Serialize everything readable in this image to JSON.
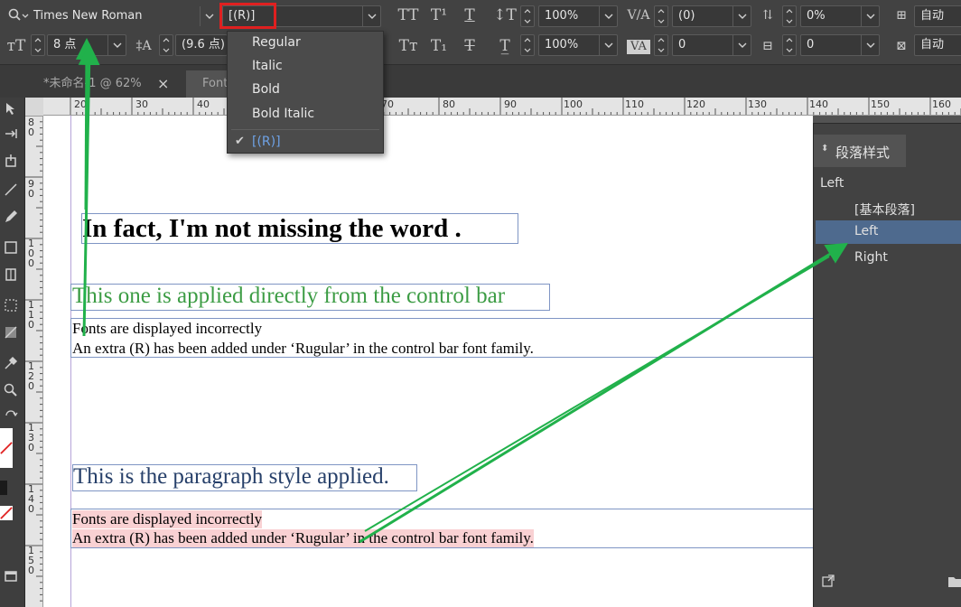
{
  "control_bar": {
    "font_family": "Times New Roman",
    "font_style": "[(R)]",
    "font_size": "8 点",
    "leading": "(9.6 点)",
    "vertical_scale": "100%",
    "horizontal_scale": "100%",
    "kerning": "(0)",
    "tracking": "0",
    "baseline_shift": "0%",
    "skew": "0",
    "auto_1": "自动",
    "auto_2": "自动"
  },
  "tabs": [
    {
      "label": "*未命名-1 @ 62%",
      "close": "×"
    },
    {
      "label": "Font"
    }
  ],
  "font_style_menu": {
    "items": [
      "Regular",
      "Italic",
      "Bold",
      "Bold Italic",
      "[(R)]"
    ],
    "selected_index": 4,
    "check": "✔"
  },
  "ruler_h": [
    "20",
    "30",
    "40",
    "70",
    "80",
    "90",
    "100",
    "110",
    "120",
    "130",
    "140",
    "150",
    "160"
  ],
  "ruler_v": [
    "8\n0",
    "9\n0",
    "1\n0\n0",
    "1\n1\n0",
    "1\n2\n0",
    "1\n3\n0",
    "1\n4\n0",
    "1\n5\n0"
  ],
  "document": {
    "heading": "In fact, I'm not missing the word .",
    "green_line": "This one is applied directly from the control bar",
    "block1_line1": "Fonts are displayed incorrectly",
    "block1_line2": "An extra (R) has been added under ‘Rugular’ in the control bar font family.",
    "blue_line": "This is the paragraph style applied.",
    "block2_line1": "Fonts are displayed incorrectly",
    "block2_line2": "An extra (R) has been added under ‘Rugular’ in the control bar font family."
  },
  "paragraph_styles_panel": {
    "title": "段落样式",
    "current": "Left",
    "items": [
      "[基本段落]",
      "Left",
      "Right"
    ],
    "selected_index": 1
  },
  "colors": {
    "highlight_box": "#e02020",
    "arrow": "#21b14b",
    "panel_selected": "#4e6a8e",
    "pink_highlight": "#f9d1d3",
    "green_text": "#3c9c44",
    "blue_text": "#27406a"
  }
}
